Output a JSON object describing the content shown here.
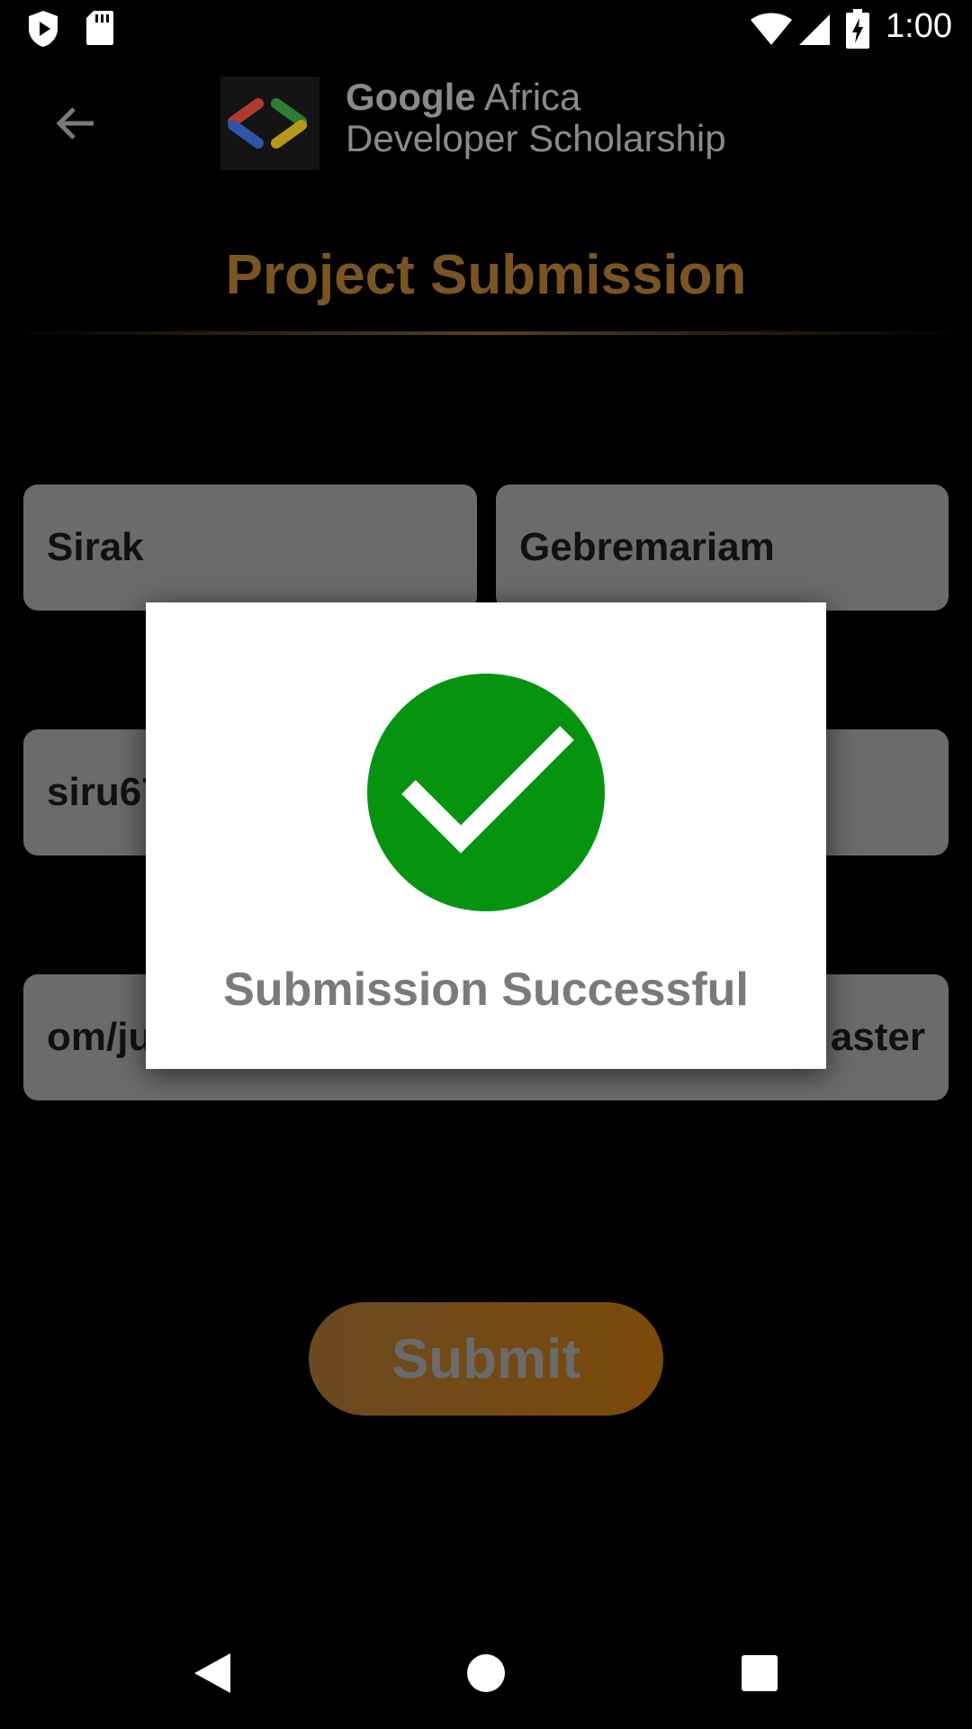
{
  "status_bar": {
    "time": "1:00"
  },
  "app_bar": {
    "logo_text_line1_bold": "Google",
    "logo_text_line1_rest": " Africa",
    "logo_text_line2": "Developer Scholarship"
  },
  "page": {
    "title": "Project Submission"
  },
  "form": {
    "first_name_value": "Sirak",
    "last_name_value": "Gebremariam",
    "email_value_visible": "siru67",
    "github_link_value_visible_left": "om/ju",
    "github_link_value_visible_right": "aster"
  },
  "submit": {
    "label": "Submit"
  },
  "dialog": {
    "message": "Submission Successful"
  },
  "colors": {
    "accent": "#7a5523",
    "success": "#069410",
    "field_bg": "#6b6b6b"
  }
}
